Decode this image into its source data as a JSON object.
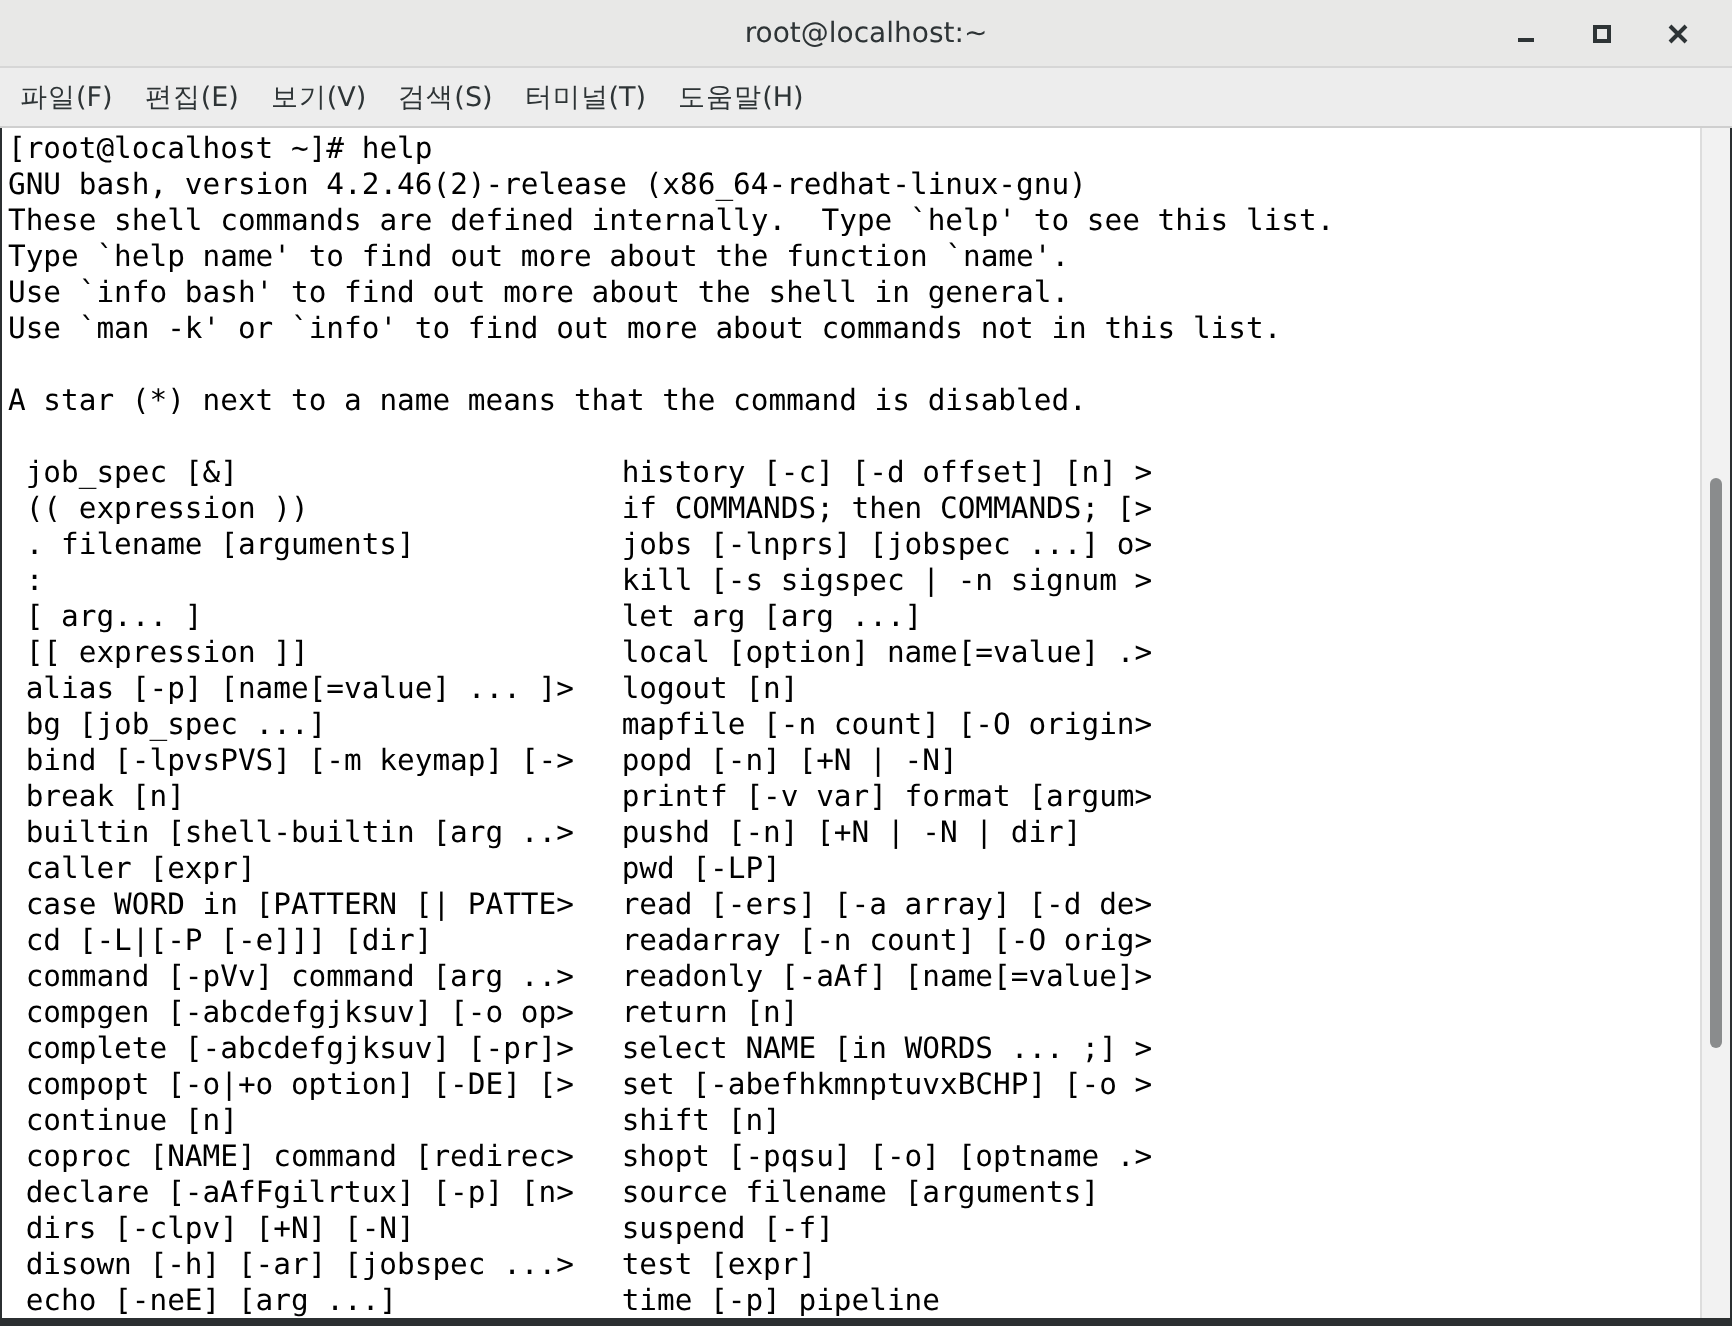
{
  "window": {
    "title": "root@localhost:~"
  },
  "menu": [
    "파일(F)",
    "편집(E)",
    "보기(V)",
    "검색(S)",
    "터미널(T)",
    "도움말(H)"
  ],
  "terminal": {
    "intro_lines": [
      "[root@localhost ~]# help",
      "GNU bash, version 4.2.46(2)-release (x86_64-redhat-linux-gnu)",
      "These shell commands are defined internally.  Type `help' to see this list.",
      "Type `help name' to find out more about the function `name'.",
      "Use `info bash' to find out more about the shell in general.",
      "Use `man -k' or `info' to find out more about commands not in this list."
    ],
    "note_line": "A star (*) next to a name means that the command is disabled.",
    "commands": [
      {
        "left": "job_spec [&]",
        "right": "history [-c] [-d offset] [n] >"
      },
      {
        "left": "(( expression ))",
        "right": "if COMMANDS; then COMMANDS; [>"
      },
      {
        "left": ". filename [arguments]",
        "right": "jobs [-lnprs] [jobspec ...] o>"
      },
      {
        "left": ":",
        "right": "kill [-s sigspec | -n signum >"
      },
      {
        "left": "[ arg... ]",
        "right": "let arg [arg ...]"
      },
      {
        "left": "[[ expression ]]",
        "right": "local [option] name[=value] .>"
      },
      {
        "left": "alias [-p] [name[=value] ... ]>",
        "right": "logout [n]"
      },
      {
        "left": "bg [job_spec ...]",
        "right": "mapfile [-n count] [-O origin>"
      },
      {
        "left": "bind [-lpvsPVS] [-m keymap] [->",
        "right": "popd [-n] [+N | -N]"
      },
      {
        "left": "break [n]",
        "right": "printf [-v var] format [argum>"
      },
      {
        "left": "builtin [shell-builtin [arg ..>",
        "right": "pushd [-n] [+N | -N | dir]"
      },
      {
        "left": "caller [expr]",
        "right": "pwd [-LP]"
      },
      {
        "left": "case WORD in [PATTERN [| PATTE>",
        "right": "read [-ers] [-a array] [-d de>"
      },
      {
        "left": "cd [-L|[-P [-e]]] [dir]",
        "right": "readarray [-n count] [-O orig>"
      },
      {
        "left": "command [-pVv] command [arg ..>",
        "right": "readonly [-aAf] [name[=value]>"
      },
      {
        "left": "compgen [-abcdefgjksuv] [-o op>",
        "right": "return [n]"
      },
      {
        "left": "complete [-abcdefgjksuv] [-pr]>",
        "right": "select NAME [in WORDS ... ;] >"
      },
      {
        "left": "compopt [-o|+o option] [-DE] [>",
        "right": "set [-abefhkmnptuvxBCHP] [-o >"
      },
      {
        "left": "continue [n]",
        "right": "shift [n]"
      },
      {
        "left": "coproc [NAME] command [redirec>",
        "right": "shopt [-pqsu] [-o] [optname .>"
      },
      {
        "left": "declare [-aAfFgilrtux] [-p] [n>",
        "right": "source filename [arguments]"
      },
      {
        "left": "dirs [-clpv] [+N] [-N]",
        "right": "suspend [-f]"
      },
      {
        "left": "disown [-h] [-ar] [jobspec ...>",
        "right": "test [expr]"
      },
      {
        "left": "echo [-neE] [arg ...]",
        "right": "time [-p] pipeline"
      }
    ]
  }
}
